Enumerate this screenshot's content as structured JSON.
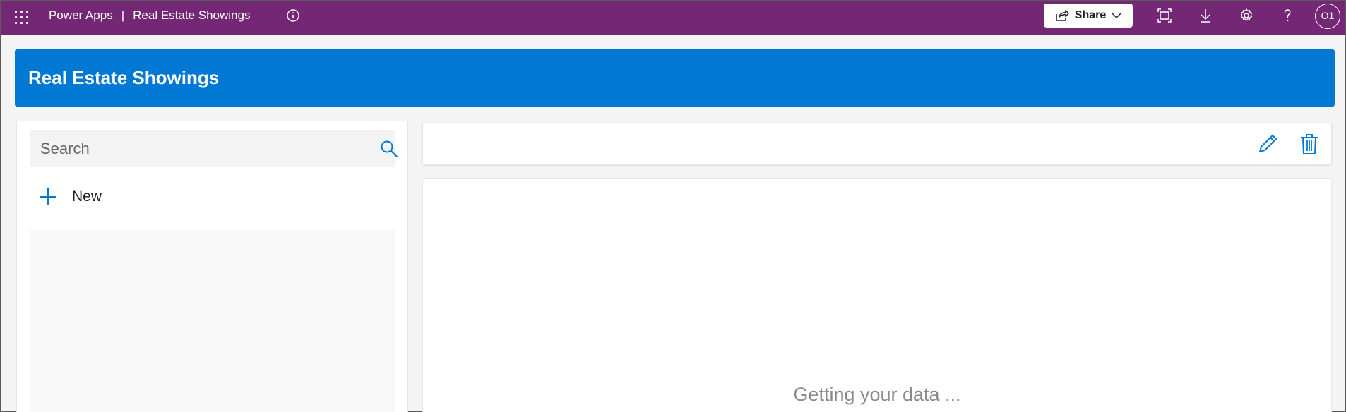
{
  "topbar": {
    "product": "Power Apps",
    "separator": "|",
    "app_name": "Real Estate Showings",
    "share_label": "Share",
    "avatar_initials": "O1",
    "icons": [
      "waffle-icon",
      "info-icon",
      "share-icon",
      "chevron-down-icon",
      "fit-to-screen-icon",
      "download-icon",
      "settings-icon",
      "help-icon"
    ],
    "background_color": "#742774"
  },
  "header": {
    "title": "Real Estate Showings",
    "background_color": "#0078d4"
  },
  "left_panel": {
    "search_placeholder": "Search",
    "search_value": "",
    "new_label": "New",
    "accent_color": "#0078d4"
  },
  "detail": {
    "loading_text": "Getting your data ..."
  }
}
